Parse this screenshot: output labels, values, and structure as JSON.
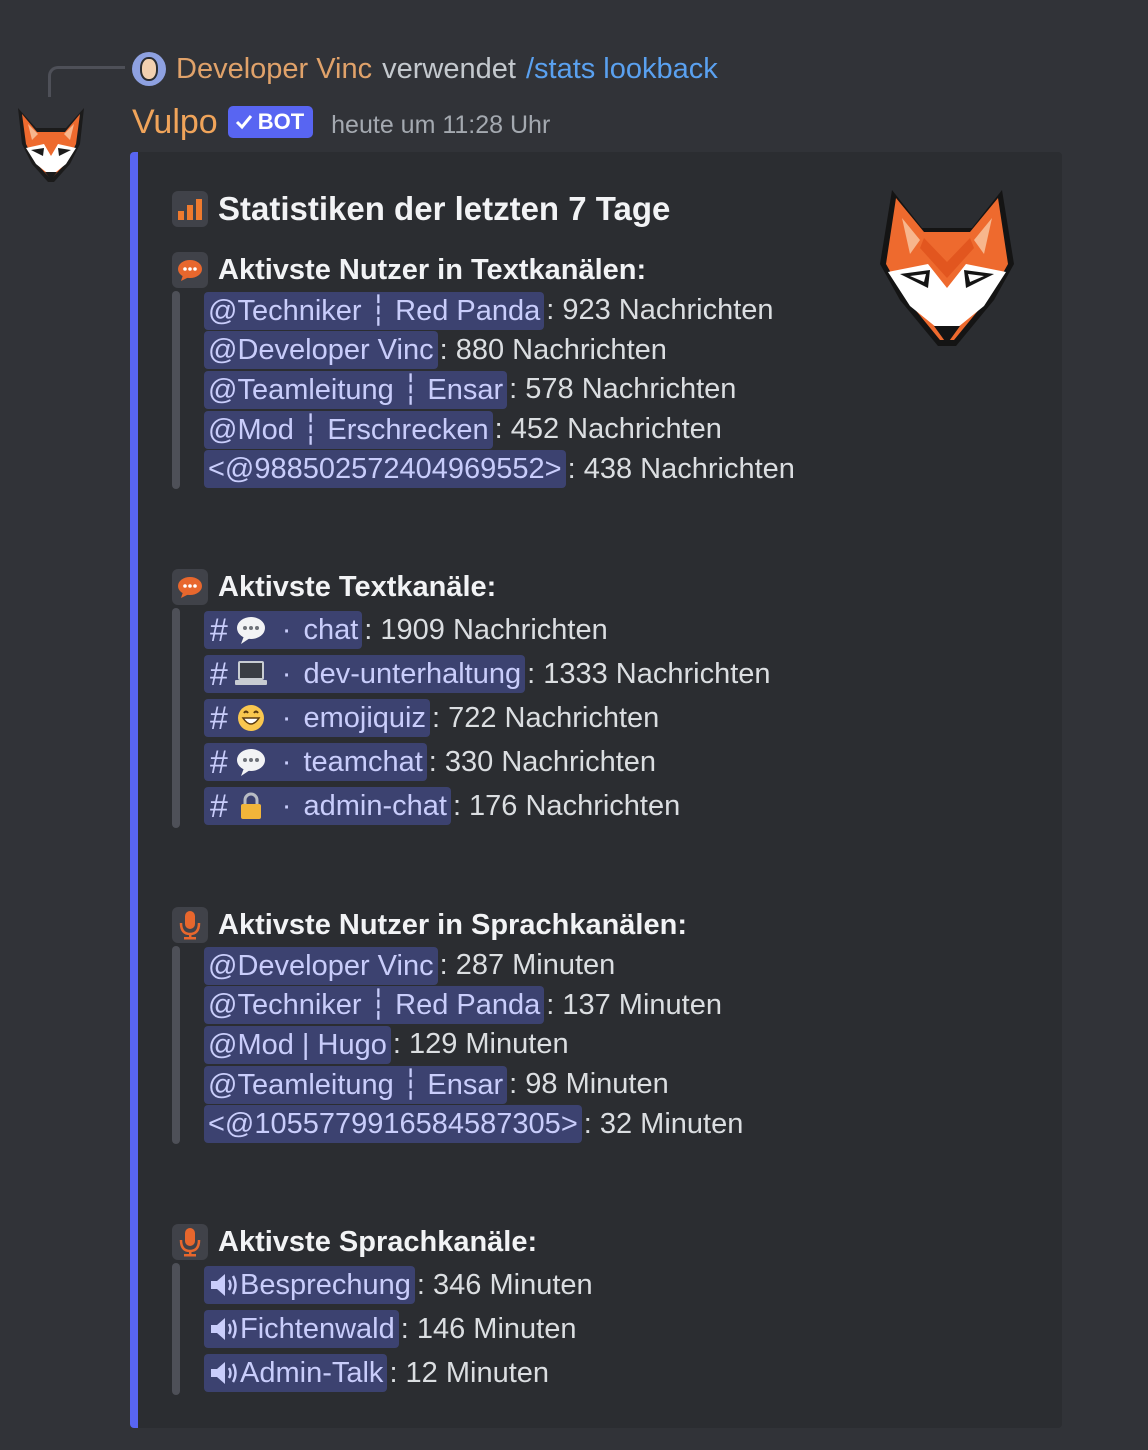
{
  "reply": {
    "user": "Developer Vinc",
    "verb": "verwendet",
    "command": "/stats lookback"
  },
  "message": {
    "username": "Vulpo",
    "bot_tag": "BOT",
    "timestamp": "heute um 11:28 Uhr"
  },
  "embed": {
    "accent_color": "#5865f2",
    "title": "Statistiken der letzten 7 Tage",
    "title_icon": "bar-chart-icon",
    "sections": {
      "text_users": {
        "title": "Aktivste Nutzer in Textkanälen:",
        "icon": "speech-balloon-icon",
        "rows": [
          {
            "mention": "@Techniker ┆ Red Panda",
            "value": ": 923 Nachrichten"
          },
          {
            "mention": "@Developer Vinc",
            "value": ": 880 Nachrichten"
          },
          {
            "mention": "@Teamleitung ┆ Ensar",
            "value": ": 578 Nachrichten"
          },
          {
            "mention": "@Mod ┆ Erschrecken",
            "value": ": 452 Nachrichten"
          },
          {
            "mention": "<@988502572404969552>",
            "value": ": 438 Nachrichten"
          }
        ]
      },
      "text_channels": {
        "title": "Aktivste Textkanäle:",
        "icon": "speech-balloon-icon",
        "rows": [
          {
            "hash": "#",
            "emoji": "speech-bubble-icon",
            "dot": "·",
            "name": "chat",
            "value": ": 1909 Nachrichten"
          },
          {
            "hash": "#",
            "emoji": "laptop-icon",
            "dot": "·",
            "name": "dev-unterhaltung",
            "value": ": 1333 Nachrichten"
          },
          {
            "hash": "#",
            "emoji": "grinning-face-icon",
            "dot": "·",
            "name": "emojiquiz",
            "value": ": 722 Nachrichten"
          },
          {
            "hash": "#",
            "emoji": "speech-bubble-icon",
            "dot": "·",
            "name": "teamchat",
            "value": ": 330 Nachrichten"
          },
          {
            "hash": "#",
            "emoji": "lock-icon",
            "dot": "·",
            "name": "admin-chat",
            "value": ": 176 Nachrichten"
          }
        ]
      },
      "voice_users": {
        "title": "Aktivste Nutzer in Sprachkanälen:",
        "icon": "microphone-icon",
        "rows": [
          {
            "mention": "@Developer Vinc",
            "value": ": 287 Minuten"
          },
          {
            "mention": "@Techniker ┆ Red Panda",
            "value": ": 137 Minuten"
          },
          {
            "mention": "@Mod | Hugo",
            "value": ": 129 Minuten"
          },
          {
            "mention": "@Teamleitung ┆ Ensar",
            "value": ": 98 Minuten"
          },
          {
            "mention": "<@1055779916584587305>",
            "value": ": 32 Minuten"
          }
        ]
      },
      "voice_channels": {
        "title": "Aktivste Sprachkanäle:",
        "icon": "microphone-icon",
        "rows": [
          {
            "icon": "speaker-icon",
            "name": "Besprechung",
            "value": ": 346 Minuten"
          },
          {
            "icon": "speaker-icon",
            "name": "Fichtenwald",
            "value": ": 146 Minuten"
          },
          {
            "icon": "speaker-icon",
            "name": "Admin-Talk",
            "value": ": 12 Minuten"
          }
        ]
      }
    }
  }
}
